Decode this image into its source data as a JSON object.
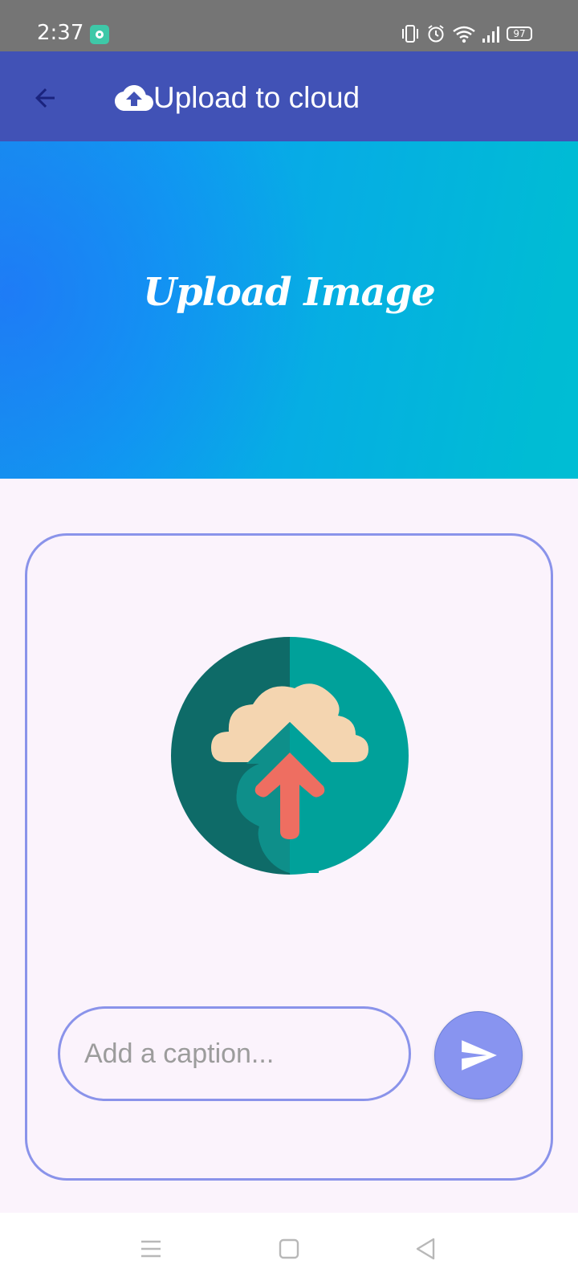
{
  "status_bar": {
    "time": "2:37",
    "battery": "97",
    "icons": [
      "app-notification-icon",
      "vibrate-icon",
      "alarm-icon",
      "wifi-icon",
      "signal-icon",
      "battery-icon"
    ]
  },
  "app_bar": {
    "title": "Upload to cloud",
    "back_icon": "arrow-back-icon",
    "title_icon": "cloud-upload-icon",
    "background_color": "#4152b6"
  },
  "banner": {
    "title": "Upload Image"
  },
  "upload_card": {
    "illustration_icon": "cloud-upload-illustration",
    "caption_placeholder": "Add a caption...",
    "caption_value": "",
    "send_icon": "send-icon",
    "accent_color": "#8a93ea"
  },
  "nav_bar": {
    "icons": [
      "menu-icon",
      "home-icon",
      "back-icon"
    ]
  }
}
